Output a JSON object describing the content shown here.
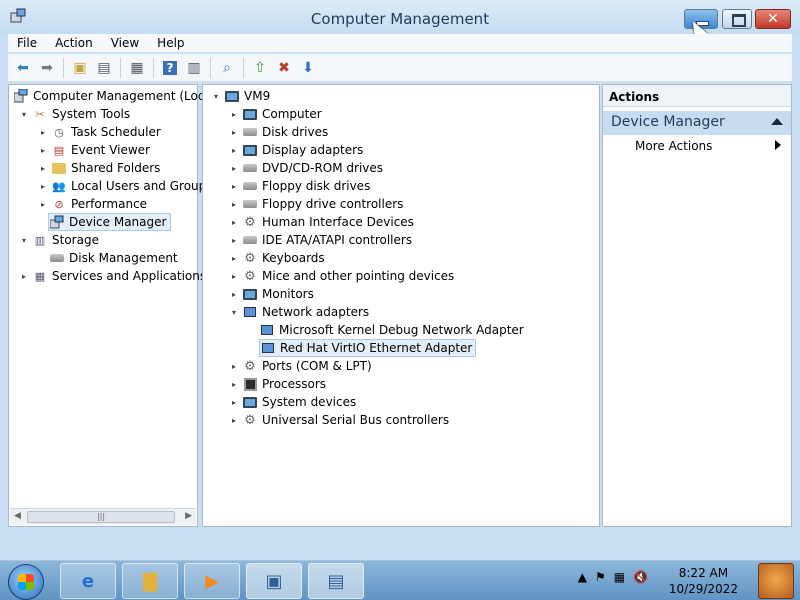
{
  "window": {
    "title": "Computer Management"
  },
  "menu": [
    "File",
    "Action",
    "View",
    "Help"
  ],
  "left_tree": [
    {
      "label": "Computer Management (Local",
      "depth": 0,
      "exp": ""
    },
    {
      "label": "System Tools",
      "depth": 1,
      "exp": "▾"
    },
    {
      "label": "Task Scheduler",
      "depth": 2,
      "exp": "▸"
    },
    {
      "label": "Event Viewer",
      "depth": 2,
      "exp": "▸"
    },
    {
      "label": "Shared Folders",
      "depth": 2,
      "exp": "▸"
    },
    {
      "label": "Local Users and Groups",
      "depth": 2,
      "exp": "▸"
    },
    {
      "label": "Performance",
      "depth": 2,
      "exp": "▸"
    },
    {
      "label": "Device Manager",
      "depth": 2,
      "exp": ""
    },
    {
      "label": "Storage",
      "depth": 1,
      "exp": "▾"
    },
    {
      "label": "Disk Management",
      "depth": 2,
      "exp": ""
    },
    {
      "label": "Services and Applications",
      "depth": 1,
      "exp": "▸"
    }
  ],
  "device_tree": {
    "root": "VM9",
    "items": [
      {
        "label": "Computer",
        "exp": "▸"
      },
      {
        "label": "Disk drives",
        "exp": "▸"
      },
      {
        "label": "Display adapters",
        "exp": "▸"
      },
      {
        "label": "DVD/CD-ROM drives",
        "exp": "▸"
      },
      {
        "label": "Floppy disk drives",
        "exp": "▸"
      },
      {
        "label": "Floppy drive controllers",
        "exp": "▸"
      },
      {
        "label": "Human Interface Devices",
        "exp": "▸"
      },
      {
        "label": "IDE ATA/ATAPI controllers",
        "exp": "▸"
      },
      {
        "label": "Keyboards",
        "exp": "▸"
      },
      {
        "label": "Mice and other pointing devices",
        "exp": "▸"
      },
      {
        "label": "Monitors",
        "exp": "▸"
      },
      {
        "label": "Network adapters",
        "exp": "▾"
      },
      {
        "label": "Microsoft Kernel Debug Network Adapter",
        "exp": "",
        "child": true
      },
      {
        "label": "Red Hat VirtIO Ethernet Adapter",
        "exp": "",
        "child": true
      },
      {
        "label": "Ports (COM & LPT)",
        "exp": "▸"
      },
      {
        "label": "Processors",
        "exp": "▸"
      },
      {
        "label": "System devices",
        "exp": "▸"
      },
      {
        "label": "Universal Serial Bus controllers",
        "exp": "▸"
      }
    ]
  },
  "actions": {
    "header": "Actions",
    "section": "Device Manager",
    "more": "More Actions"
  },
  "clock": {
    "time": "8:22 AM",
    "date": "10/29/2022"
  }
}
